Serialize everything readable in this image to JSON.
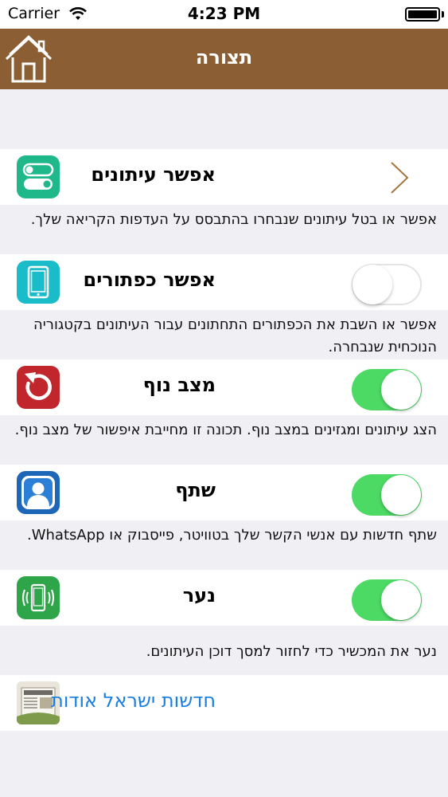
{
  "status_bar": {
    "carrier": "Carrier",
    "time": "4:23 PM"
  },
  "nav": {
    "title": "תצורה"
  },
  "rows": [
    {
      "label": "אפשר עיתונים",
      "description": "אפשר או בטל עיתונים שנבחרו בהתבסס על העדפות הקריאה שלך."
    },
    {
      "label": "אפשר כפתורים",
      "description": "אפשר או השבת את הכפתורים התחתונים עבור העיתונים בקטגוריה הנוכחית שנבחרה.",
      "toggle_on": false
    },
    {
      "label": "מצב נוף",
      "description": "הצג עיתונים ומגזינים במצב נוף. תכונה זו מחייבת איפשור של מצב נוף.",
      "toggle_on": true
    },
    {
      "label": "שתף",
      "description": "שתף חדשות עם אנשי הקשר שלך בטוויטר, פייסבוק או WhatsApp.",
      "toggle_on": true
    },
    {
      "label": "נער",
      "description": "נער את המכשיר כדי לחזור למסך דוכן העיתונים.",
      "toggle_on": true
    }
  ],
  "about": {
    "label": "חדשות ישראל אודות"
  },
  "colors": {
    "nav_bg": "#8b5e34",
    "toggle_on": "#4cd964",
    "link": "#1a7ee0",
    "icon_switches": "#1fb88a",
    "icon_buttons": "#1bbcc9",
    "icon_rotate": "#c0262b",
    "icon_share": "#1e66b8",
    "icon_shake": "#2fa54a"
  }
}
